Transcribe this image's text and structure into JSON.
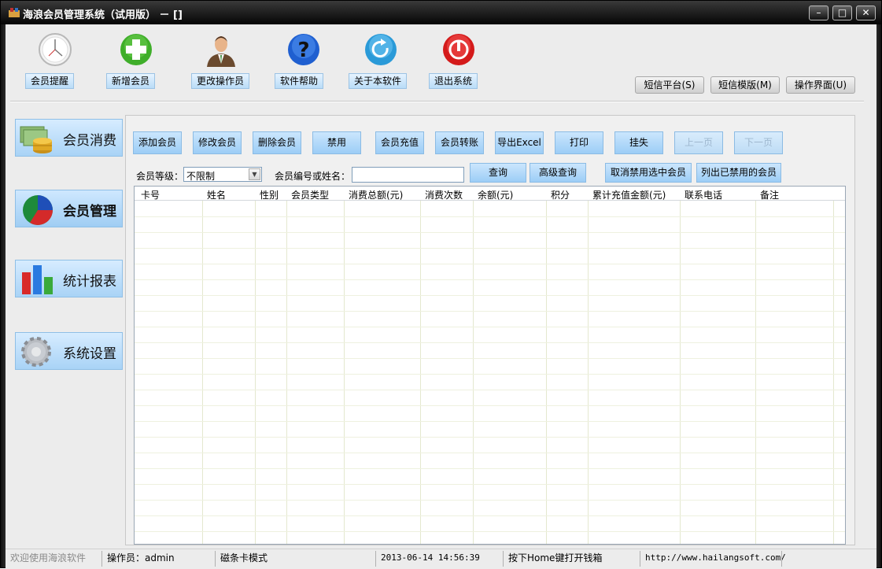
{
  "window": {
    "title": "海浪会员管理系统（试用版） － []",
    "minimize_label": "–",
    "maximize_label": "□",
    "close_label": "✕"
  },
  "toolbar": {
    "items": [
      {
        "label": "会员提醒",
        "icon": "clock-icon"
      },
      {
        "label": "新增会员",
        "icon": "plus-icon"
      },
      {
        "label": "更改操作员",
        "icon": "operator-icon"
      },
      {
        "label": "软件帮助",
        "icon": "help-icon"
      },
      {
        "label": "关于本软件",
        "icon": "refresh-icon"
      },
      {
        "label": "退出系统",
        "icon": "power-icon"
      }
    ],
    "right_buttons": [
      "短信平台(S)",
      "短信模版(M)",
      "操作界面(U)"
    ]
  },
  "sidebar": {
    "items": [
      {
        "label": "会员消费",
        "icon": "coins-icon",
        "active": false
      },
      {
        "label": "会员管理",
        "icon": "pie-chart-icon",
        "active": true
      },
      {
        "label": "统计报表",
        "icon": "bar-chart-icon",
        "active": false
      },
      {
        "label": "系统设置",
        "icon": "gear-icon",
        "active": false
      }
    ]
  },
  "actions": {
    "buttons": [
      "添加会员",
      "修改会员",
      "删除会员",
      "禁用",
      "会员充值",
      "会员转账",
      "导出Excel",
      "打印",
      "挂失",
      "上一页",
      "下一页"
    ]
  },
  "search": {
    "level_label": "会员等级：",
    "level_value": "不限制",
    "name_label": "会员编号或姓名：",
    "name_value": "",
    "query_button": "查询",
    "advanced_button": "高级查询",
    "cancel_disable_button": "取消禁用选中会员",
    "list_disabled_button": "列出已禁用的会员"
  },
  "table": {
    "columns": [
      "卡号",
      "姓名",
      "性别",
      "会员类型",
      "消费总额(元)",
      "消费次数",
      "余额(元)",
      "积分",
      "累计充值金额(元)",
      "联系电话",
      "备注"
    ],
    "rows": []
  },
  "statusbar": {
    "welcome": "欢迎使用海浪软件",
    "operator": "操作员：admin",
    "mode": "磁条卡模式",
    "datetime": "2013-06-14 14:56:39",
    "hint": "按下Home键打开钱箱",
    "url": "http://www.hailangsoft.com/"
  },
  "colors": {
    "title_bg": "#111111",
    "button_blue": "#a9d3f6",
    "grid_line": "#e4e8cf"
  }
}
